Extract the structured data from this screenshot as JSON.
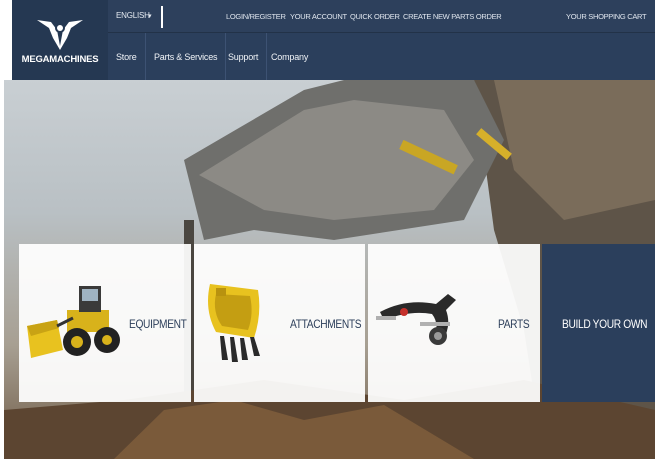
{
  "brand": {
    "name": "MEGAMACHINES",
    "logo_icon": "winged-shield-logo"
  },
  "topbar": {
    "language": "ENGLISH",
    "links": [
      "LOGIN/REGISTER",
      "YOUR ACCOUNT",
      "QUICK ORDER",
      "CREATE NEW PARTS ORDER"
    ],
    "cart": "YOUR SHOPPING CART"
  },
  "nav": {
    "items": [
      "Store",
      "Parts & Services",
      "Support",
      "Company"
    ]
  },
  "tiles": [
    {
      "label": "EQUIPMENT",
      "icon": "wheel-loader-icon"
    },
    {
      "label": "ATTACHMENTS",
      "icon": "excavator-bucket-icon"
    },
    {
      "label": "PARTS",
      "icon": "suspension-arm-icon"
    },
    {
      "label": "BUILD YOUR OWN"
    }
  ],
  "colors": {
    "navy": "#2b3f5c",
    "accent_yellow": "#e8c21f",
    "tile_bg": "#ffffff"
  }
}
